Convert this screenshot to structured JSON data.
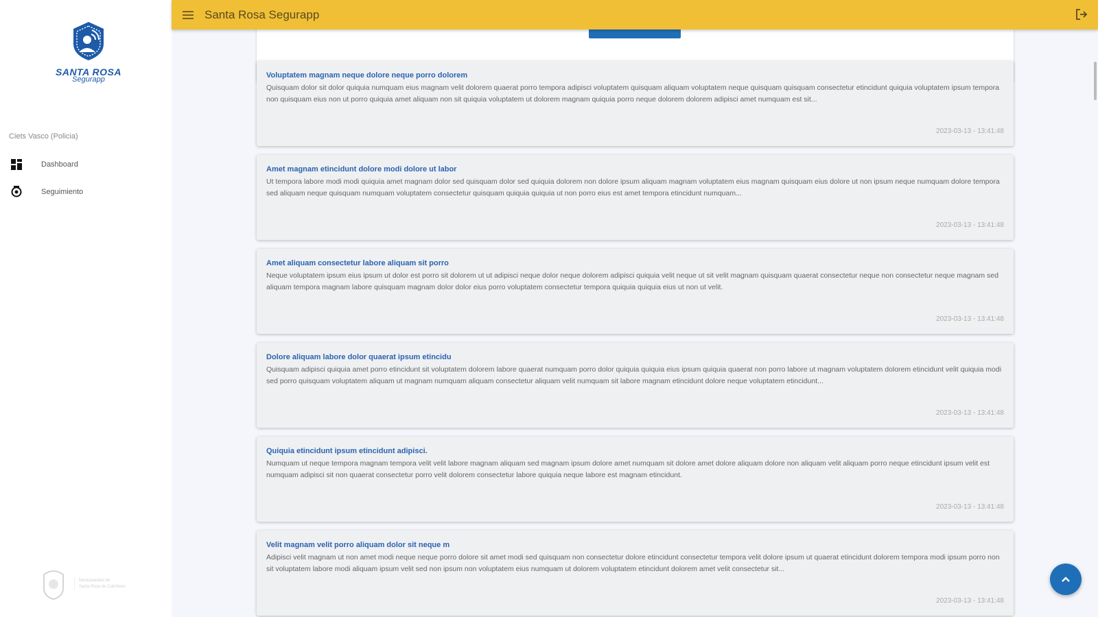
{
  "app": {
    "title": "Santa Rosa Segurapp",
    "logo_title": "SANTA ROSA",
    "logo_subtitle": "Segurapp"
  },
  "sidebar": {
    "user_label": "Ciets Vasco (Policia)",
    "items": [
      {
        "label": "Dashboard",
        "icon": "dashboard-icon"
      },
      {
        "label": "Seguimiento",
        "icon": "tracking-icon"
      }
    ],
    "footer_logo_text": [
      "Municipalidad de",
      "Santa Rosa de Calchines"
    ]
  },
  "colors": {
    "header": "#f0bf36",
    "primary": "#1f6fb8",
    "title": "#2b63b0"
  },
  "cards": [
    {
      "title": "Voluptatem magnam neque dolore neque porro dolorem",
      "body": "Quisquam dolor sit dolor quiquia numquam eius magnam velit dolorem quaerat porro tempora adipisci voluptatem quisquam aliquam voluptatem neque quisquam quisquam consectetur etincidunt quiquia voluptatem ipsum tempora non quisquam eius non ut porro quiquia amet aliquam non sit quiquia voluptatem ut dolorem magnam quiquia porro neque dolorem dolorem adipisci amet numquam est sit...",
      "date": "2023-03-13 - 13:41:48"
    },
    {
      "title": "Amet magnam etincidunt dolore modi dolore ut labor",
      "body": "Ut tempora labore modi modi quiquia amet magnam dolor sed quisquam dolor sed quiquia dolorem non dolore ipsum aliquam magnam voluptatem eius magnam quisquam eius dolore ut non ipsum neque numquam dolore tempora sed aliquam neque quisquam numquam voluptatem consectetur quisquam quiquia quiquia ut non porro eius est amet tempora etincidunt numquam...",
      "date": "2023-03-13 - 13:41:48"
    },
    {
      "title": "Amet aliquam consectetur labore aliquam sit porro",
      "body": "Neque voluptatem ipsum eius ipsum ut dolor est porro sit dolorem ut ut adipisci neque dolor neque dolorem adipisci quiquia velit neque ut sit velit magnam quisquam quaerat consectetur neque non consectetur neque magnam sed aliquam tempora magnam labore quisquam magnam dolor dolor eius porro voluptatem consectetur tempora quiquia quiquia eius ut non ut velit.",
      "date": "2023-03-13 - 13:41:48"
    },
    {
      "title": "Dolore aliquam labore dolor quaerat ipsum etincidu",
      "body": "Quisquam adipisci quiquia amet porro etincidunt sit voluptatem dolorem labore quaerat numquam porro dolor quiquia quiquia eius ipsum quiquia quaerat non porro labore ut magnam voluptatem dolorem etincidunt velit quiquia modi sed porro quisquam voluptatem aliquam ut magnam numquam aliquam consectetur aliquam velit numquam sit labore magnam etincidunt dolore neque voluptatem etincidunt...",
      "date": "2023-03-13 - 13:41:48"
    },
    {
      "title": "Quiquia etincidunt ipsum etincidunt adipisci.",
      "body": "Numquam ut neque tempora magnam tempora velit velit labore magnam aliquam sed magnam ipsum dolore amet numquam sit dolore amet dolore aliquam dolore non aliquam velit aliquam porro neque etincidunt ipsum velit est numquam adipisci sit non quaerat consectetur porro velit dolorem consectetur labore quiquia neque labore est magnam etincidunt.",
      "date": "2023-03-13 - 13:41:48"
    },
    {
      "title": "Velit magnam velit porro aliquam dolor sit neque m",
      "body": "Adipisci velit magnam ut non amet modi neque neque porro dolore sit amet modi sed quisquam non consectetur dolore etincidunt consectetur tempora velit dolore ipsum ut quaerat etincidunt dolorem tempora modi ipsum porro non sit voluptatem labore modi aliquam ipsum velit sed non ipsum non voluptatem eius numquam ut dolorem voluptatem etincidunt dolorem amet velit consectetur sit...",
      "date": "2023-03-13 - 13:41:48"
    }
  ]
}
